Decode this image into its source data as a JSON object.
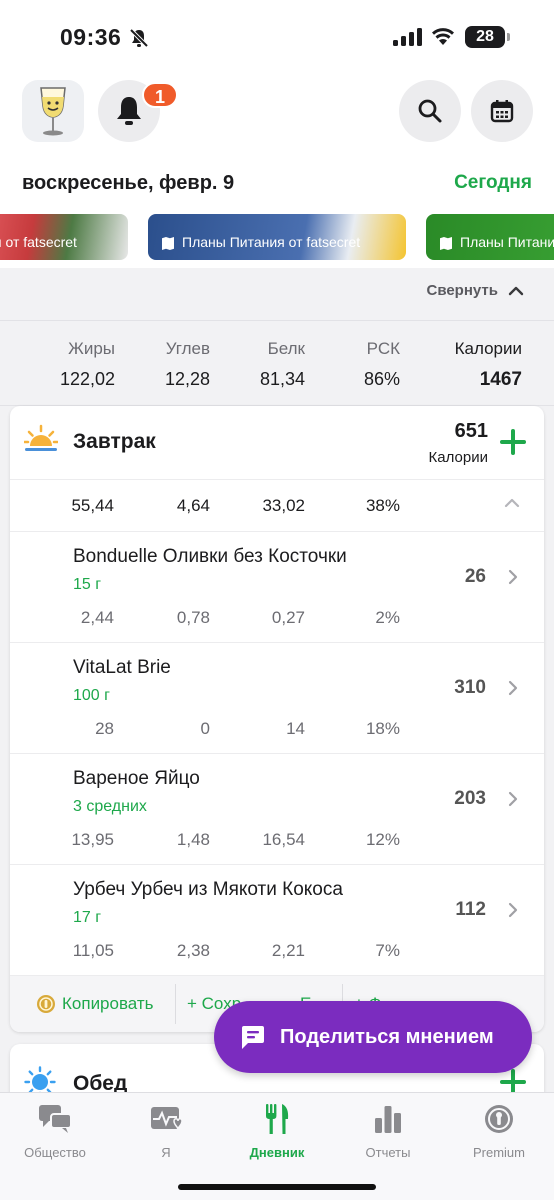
{
  "status_bar": {
    "time": "09:36",
    "battery": "28"
  },
  "header": {
    "notification_count": "1",
    "date": "воскресенье, февр. 9",
    "today_label": "Сегодня"
  },
  "banners": [
    {
      "label": "я от fatsecret"
    },
    {
      "label": "Планы Питания от fatsecret"
    },
    {
      "label": "Планы Питани"
    }
  ],
  "collapse_label": "Свернуть",
  "totals": {
    "columns": [
      {
        "label": "Жиры",
        "value": "122,02"
      },
      {
        "label": "Углев",
        "value": "12,28"
      },
      {
        "label": "Белк",
        "value": "81,34"
      },
      {
        "label": "РСК",
        "value": "86%"
      },
      {
        "label": "Калории",
        "value": "1467"
      }
    ]
  },
  "breakfast": {
    "title": "Завтрак",
    "calories": "651",
    "calories_unit": "Калории",
    "summary": [
      "55,44",
      "4,64",
      "33,02",
      "38%"
    ],
    "items": [
      {
        "name": "Bonduelle Оливки без Косточки",
        "portion": "15 г",
        "calories": "26",
        "macros": [
          "2,44",
          "0,78",
          "0,27",
          "2%"
        ]
      },
      {
        "name": "VitaLat Brie",
        "portion": "100 г",
        "calories": "310",
        "macros": [
          "28",
          "0",
          "14",
          "18%"
        ]
      },
      {
        "name": "Вареное Яйцо",
        "portion": "3 средних",
        "calories": "203",
        "macros": [
          "13,95",
          "1,48",
          "16,54",
          "12%"
        ]
      },
      {
        "name": "Урбеч Урбеч из Мякоти Кокоса",
        "portion": "17 г",
        "calories": "112",
        "macros": [
          "11,05",
          "2,38",
          "2,21",
          "7%"
        ]
      }
    ],
    "footer": {
      "copy": "Копировать",
      "save": "+ Сохр",
      "third": "Е",
      "fourth": "+ Ф"
    }
  },
  "lunch": {
    "title": "Обед"
  },
  "feedback_label": "Поделиться мнением",
  "tabs": [
    {
      "label": "Общество",
      "icon": "chat-icon"
    },
    {
      "label": "Я",
      "icon": "heart-pulse-icon"
    },
    {
      "label": "Дневник",
      "icon": "fork-knife-icon"
    },
    {
      "label": "Отчеты",
      "icon": "bar-chart-icon"
    },
    {
      "label": "Premium",
      "icon": "premium-icon"
    }
  ],
  "colors": {
    "accent_green": "#1ea84b",
    "badge_orange": "#f05b2a",
    "feedback_purple": "#7b2cbf"
  }
}
